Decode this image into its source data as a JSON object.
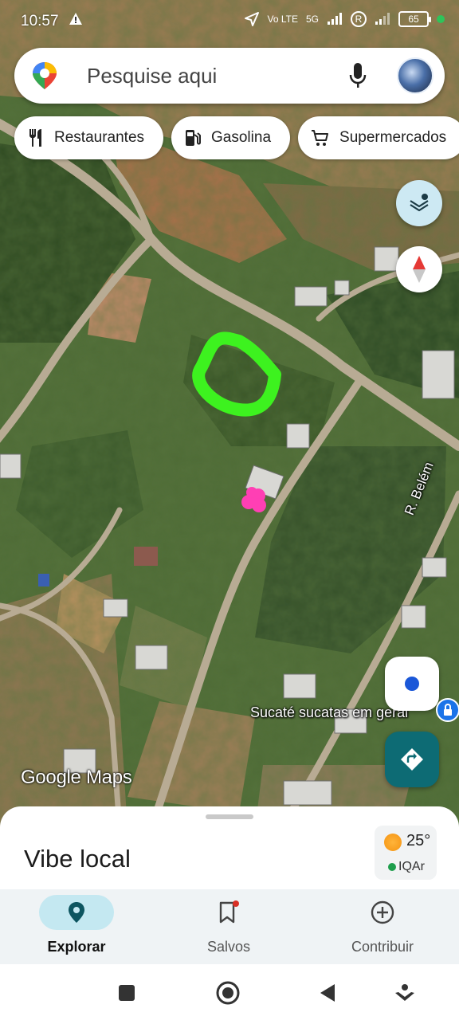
{
  "status_bar": {
    "time": "10:57",
    "network": "5G",
    "volte_label": "Vo LTE",
    "roaming_label": "R",
    "battery_level": "65"
  },
  "search": {
    "placeholder": "Pesquise aqui"
  },
  "chips": [
    {
      "label": "Restaurantes",
      "icon": "fork-knife-icon"
    },
    {
      "label": "Gasolina",
      "icon": "gas-station-icon"
    },
    {
      "label": "Supermercados",
      "icon": "shopping-cart-icon"
    }
  ],
  "map": {
    "street_label": "R. Belém",
    "poi_label": "Sucaté sucatas em geral",
    "watermark": "Google Maps",
    "colors": {
      "highlight_stroke": "#3df21f",
      "marker": "#ff3fb4"
    }
  },
  "sheet": {
    "title": "Vibe local"
  },
  "weather": {
    "temperature": "25°",
    "air_quality": "IQAr"
  },
  "bottom_nav": {
    "explore": "Explorar",
    "saved": "Salvos",
    "contribute": "Contribuir"
  }
}
